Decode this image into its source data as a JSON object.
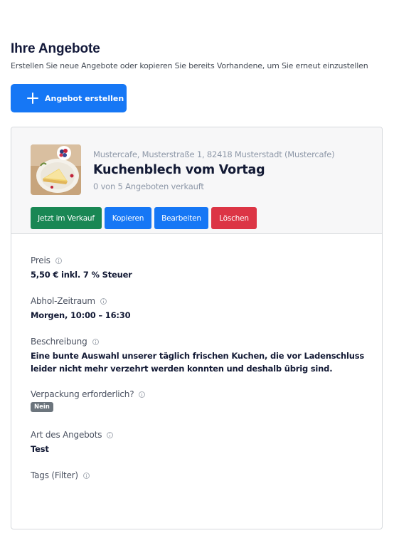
{
  "header": {
    "title": "Ihre Angebote",
    "subtitle": "Erstellen Sie neue Angebote oder kopieren Sie bereits Vorhandene, um Sie erneut einzustellen"
  },
  "create_button": {
    "label": "Angebot erstellen",
    "icon": "plus-icon"
  },
  "offer": {
    "location": "Mustercafe, Musterstraße 1, 82418 Musterstadt (Mustercafe)",
    "title": "Kuchenblech vom Vortag",
    "sold": "0 von 5 Angeboten verkauft",
    "actions": {
      "on_sale": "Jetzt im Verkauf",
      "copy": "Kopieren",
      "edit": "Bearbeiten",
      "delete": "Löschen"
    },
    "fields": {
      "price": {
        "label": "Preis",
        "value": "5,50 € inkl. 7 % Steuer"
      },
      "pickup": {
        "label": "Abhol-Zeitraum",
        "value": "Morgen, 10:00 – 16:30"
      },
      "description": {
        "label": "Beschreibung",
        "value": "Eine bunte Auswahl unserer täglich frischen Kuchen, die vor Ladenschluss leider nicht mehr verzehrt werden konnten und deshalb übrig sind."
      },
      "packaging": {
        "label": "Verpackung erforderlich?",
        "value": "Nein"
      },
      "offer_type": {
        "label": "Art des Angebots",
        "value": "Test"
      },
      "tags": {
        "label": "Tags (Filter)"
      }
    }
  },
  "colors": {
    "primary": "#1677f5",
    "success": "#198754",
    "danger": "#dc3545",
    "badge": "#6c757d"
  }
}
